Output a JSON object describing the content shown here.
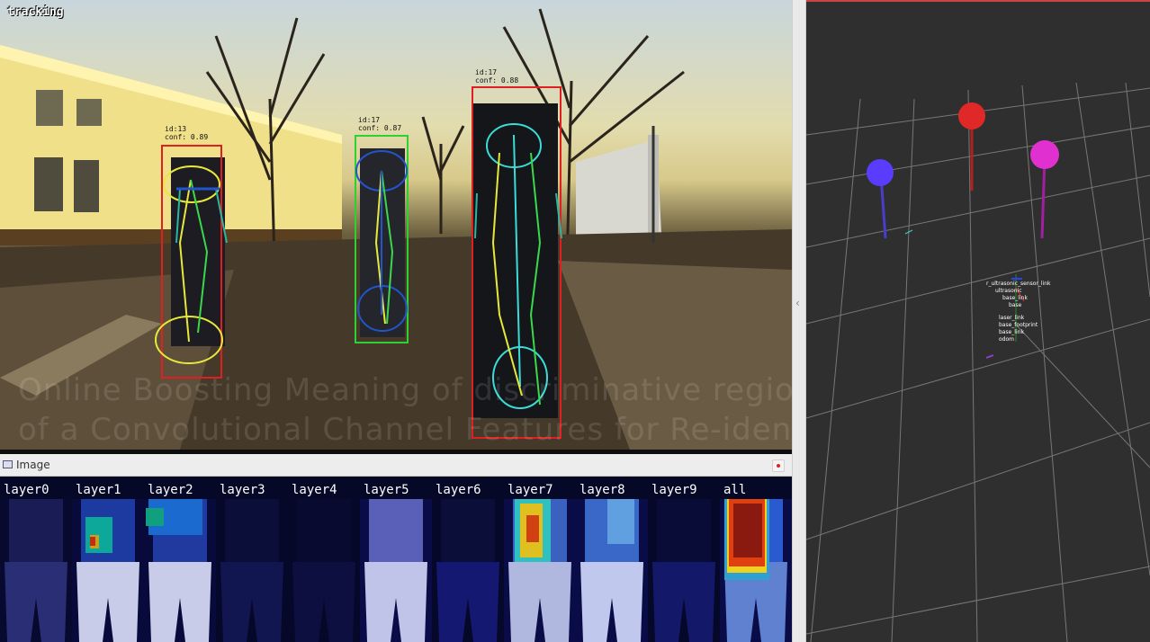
{
  "camera": {
    "title": "tracking",
    "tracks": [
      {
        "id_text": "id:13",
        "conf_text": "conf: 0.89",
        "color": "#e02020"
      },
      {
        "id_text": "id:17",
        "conf_text": "conf: 0.87",
        "color": "#30d030"
      },
      {
        "id_text": "id:17",
        "conf_text": "conf: 0.88",
        "color": "#e02020"
      }
    ],
    "watermark_line1": "Online Boosting Meaning of discriminative regions",
    "watermark_line2": "of a Convolutional Channel Features for Re-identification"
  },
  "image_panel": {
    "title": "Image",
    "layers": [
      "layer0",
      "layer1",
      "layer2",
      "layer3",
      "layer4",
      "layer5",
      "layer6",
      "layer7",
      "layer8",
      "layer9",
      "all"
    ]
  },
  "rviz": {
    "markers": [
      {
        "name": "blue",
        "color": "#5a3cff"
      },
      {
        "name": "red",
        "color": "#e02828"
      },
      {
        "name": "magenta",
        "color": "#e030d0"
      }
    ],
    "frame_labels": [
      "r_ultrasonic_sensor_link",
      "ultrasonic",
      "base_link",
      "base",
      "laser_link",
      "base_footprint",
      "base_link",
      "odom"
    ]
  }
}
